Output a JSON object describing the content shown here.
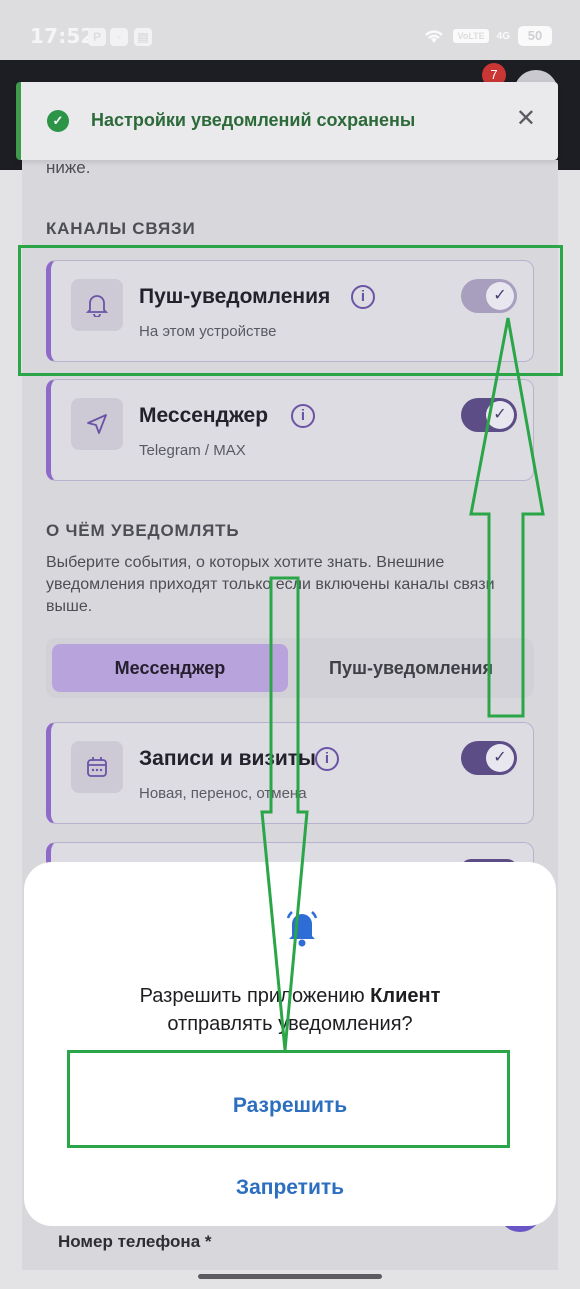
{
  "status_bar": {
    "time": "17:52",
    "volte": "VoLTE",
    "network": "4G",
    "battery": "50",
    "icons": [
      "wifi-icon",
      "signal-icon",
      "battery-icon"
    ]
  },
  "header": {
    "notification_count": "7"
  },
  "toast": {
    "message": "Настройки уведомлений сохранены",
    "close": "✕"
  },
  "page": {
    "intro_tail": "ниже.",
    "channels_title": "КАНАЛЫ СВЯЗИ",
    "channels": [
      {
        "title": "Пуш-уведомления",
        "subtitle": "На этом устройстве",
        "icon": "bell-icon",
        "enabled": true
      },
      {
        "title": "Мессенджер",
        "subtitle": "Telegram / MAX",
        "icon": "send-icon",
        "enabled": true
      }
    ],
    "events_title": "О ЧЁМ УВЕДОМЛЯТЬ",
    "events_description": "Выберите события, о которых хотите знать. Внешние уведомления приходят только если включены каналы связи выше.",
    "tabs": [
      "Мессенджер",
      "Пуш-уведомления"
    ],
    "events": [
      {
        "title": "Записи и визиты",
        "subtitle": "Новая, перенос, отмена",
        "icon": "calendar-icon",
        "enabled": true
      }
    ],
    "phone_label": "Номер телефона *"
  },
  "dialog": {
    "text_prefix": "Разрешить приложению ",
    "app_name": "Клиент",
    "text_suffix": "отправлять уведомления?",
    "allow": "Разрешить",
    "deny": "Запретить"
  },
  "colors": {
    "accent": "#8e6ac9",
    "annotation": "#2aa648",
    "dialog_button": "#2d6fbf"
  }
}
